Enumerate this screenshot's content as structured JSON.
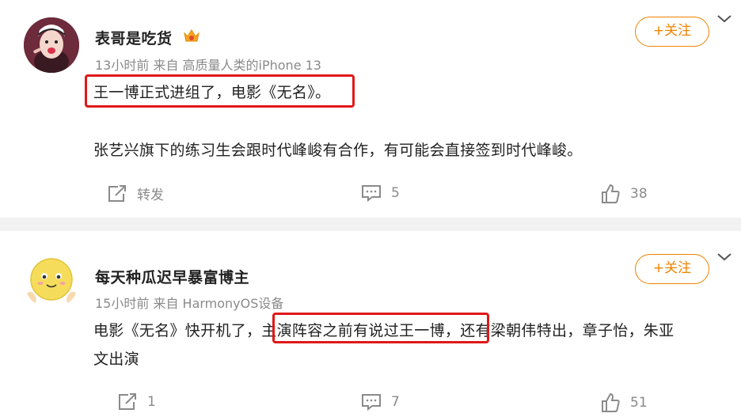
{
  "posts": [
    {
      "username": "表哥是吃货",
      "meta": "13小时前 来自 高质量人类的iPhone 13",
      "follow_label": "+关注",
      "text_lines": [
        "王一博正式进组了，电影《无名》。",
        "张艺兴旗下的练习生会跟时代峰峻有合作，有可能会直接签到时代峰峻。"
      ],
      "actions": {
        "repost": "转发",
        "comments": "5",
        "likes": "38"
      }
    },
    {
      "username": "每天种瓜迟早暴富博主",
      "meta": "15小时前 来自 HarmonyOS设备",
      "follow_label": "+关注",
      "text_lines": [
        "电影《无名》快开机了，主演阵容之前有说过王一博，还有梁朝伟特出，章子怡，朱亚",
        "文出演"
      ],
      "actions": {
        "repost": "1",
        "comments": "7",
        "likes": "51"
      }
    }
  ],
  "colors": {
    "accent": "#f08200",
    "highlight": "#e01818",
    "meta": "#8a8a8a",
    "text": "#222222",
    "divider": "#f2f2f2"
  },
  "icons": {
    "vip": "vip-crown-icon",
    "repost": "repost-icon",
    "comment": "comment-icon",
    "like": "thumbs-up-icon",
    "menu": "chevron-down-icon"
  }
}
